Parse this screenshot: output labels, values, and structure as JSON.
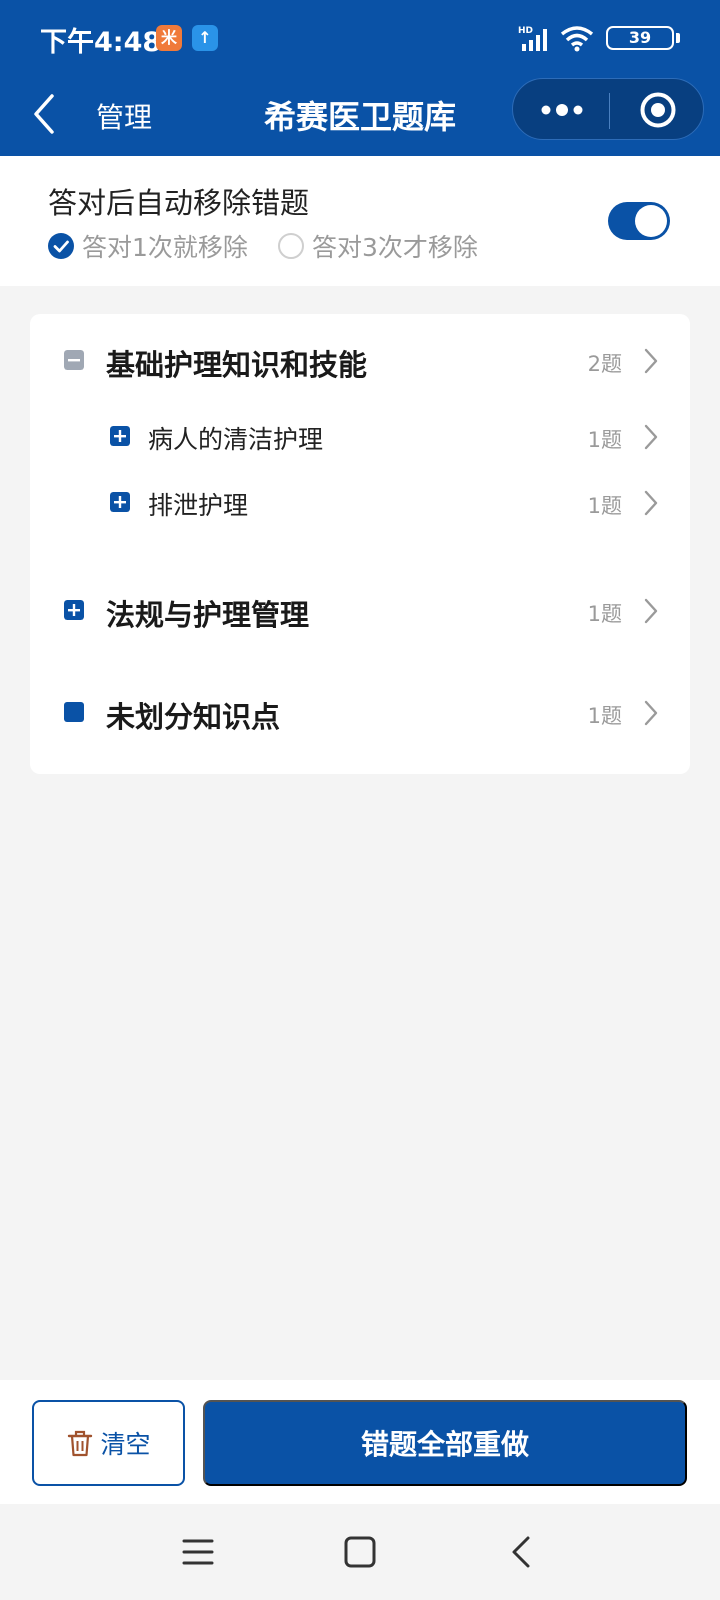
{
  "status_bar": {
    "time": "下午4:48",
    "battery": "39",
    "network": "HD"
  },
  "nav": {
    "back_label": "管理",
    "title": "希赛医卫题库"
  },
  "settings": {
    "title": "答对后自动移除错题",
    "auto_remove_enabled": true,
    "options": [
      {
        "label": "答对1次就移除",
        "selected": true
      },
      {
        "label": "答对3次才移除",
        "selected": false
      }
    ]
  },
  "categories": [
    {
      "label": "基础护理知识和技能",
      "count": "2题",
      "level": 1,
      "icon": "minus-square-icon"
    },
    {
      "label": "病人的清洁护理",
      "count": "1题",
      "level": 2,
      "icon": "plus-square-icon"
    },
    {
      "label": "排泄护理",
      "count": "1题",
      "level": 2,
      "icon": "plus-square-icon"
    },
    {
      "label": "法规与护理管理",
      "count": "1题",
      "level": 1,
      "icon": "plus-square-icon"
    },
    {
      "label": "未划分知识点",
      "count": "1题",
      "level": 1,
      "icon": "square-icon"
    }
  ],
  "actions": {
    "clear_label": "清空",
    "redo_all_label": "错题全部重做"
  },
  "colors": {
    "primary": "#0a52a6",
    "muted_text": "#9a9a9a",
    "collapse_icon": "#a0a8b4"
  }
}
